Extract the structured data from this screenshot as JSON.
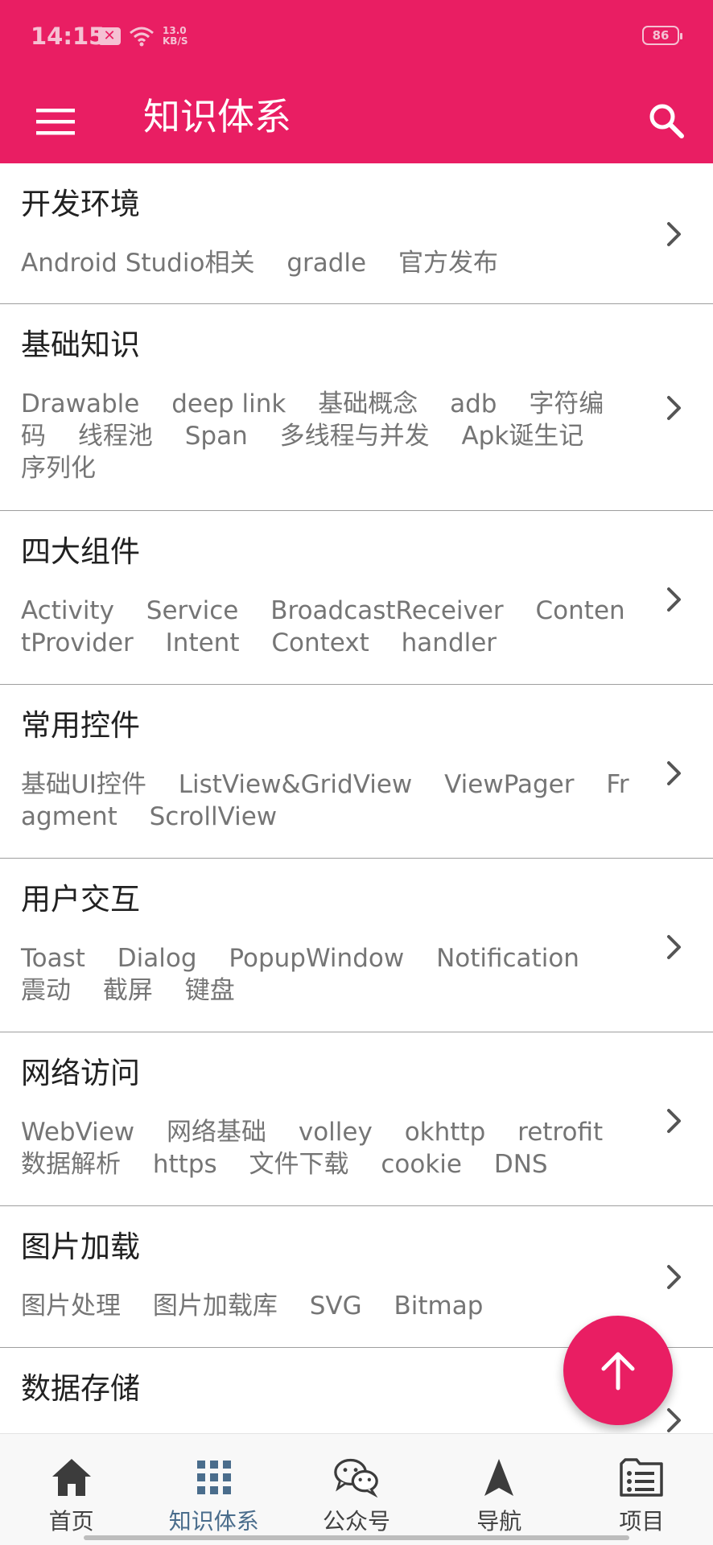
{
  "status_bar": {
    "time": "14:15",
    "speed_value": "13.0",
    "speed_unit": "KB/S",
    "battery": "86"
  },
  "toolbar": {
    "title": "知识体系",
    "menu_icon": "hamburger-menu-icon",
    "search_icon": "search-icon"
  },
  "categories": [
    {
      "title": "开发环境",
      "tags": [
        "Android Studio相关",
        "gradle",
        "官方发布"
      ]
    },
    {
      "title": "基础知识",
      "tags": [
        "Drawable",
        "deep link",
        "基础概念",
        "adb",
        "字符编码",
        "线程池",
        "Span",
        "多线程与并发",
        "Apk诞生记",
        "序列化"
      ]
    },
    {
      "title": "四大组件",
      "tags": [
        "Activity",
        "Service",
        "BroadcastReceiver",
        "ContentProvider",
        "Intent",
        "Context",
        "handler"
      ]
    },
    {
      "title": "常用控件",
      "tags": [
        "基础UI控件",
        "ListView&GridView",
        "ViewPager",
        "Fragment",
        "ScrollView"
      ]
    },
    {
      "title": "用户交互",
      "tags": [
        "Toast",
        "Dialog",
        "PopupWindow",
        "Notification",
        "震动",
        "截屏",
        "键盘"
      ]
    },
    {
      "title": "网络访问",
      "tags": [
        "WebView",
        "网络基础",
        "volley",
        "okhttp",
        "retrofit",
        "数据解析",
        "https",
        "文件下载",
        "cookie",
        "DNS"
      ]
    },
    {
      "title": "图片加载",
      "tags": [
        "图片处理",
        "图片加载库",
        "SVG",
        "Bitmap"
      ]
    },
    {
      "title": "数据存储",
      "tags": []
    }
  ],
  "fab": {
    "icon": "arrow-up-icon"
  },
  "bottom_nav": {
    "active_index": 1,
    "items": [
      {
        "label": "首页",
        "icon": "home-icon"
      },
      {
        "label": "知识体系",
        "icon": "grid-icon"
      },
      {
        "label": "公众号",
        "icon": "wechat-icon"
      },
      {
        "label": "导航",
        "icon": "navigation-arrow-icon"
      },
      {
        "label": "项目",
        "icon": "project-list-icon"
      }
    ]
  },
  "colors": {
    "primary": "#e91e63",
    "active_nav": "#4a6d8c",
    "tag_text": "#757575",
    "title_text": "#212121"
  }
}
